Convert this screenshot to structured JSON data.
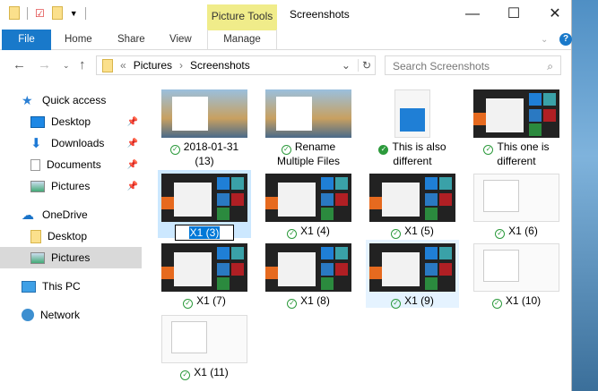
{
  "window": {
    "title": "Screenshots",
    "context_tab": "Picture Tools"
  },
  "ribbon": {
    "tabs": [
      "File",
      "Home",
      "Share",
      "View",
      "Manage"
    ]
  },
  "nav": {
    "breadcrumb": [
      "Pictures",
      "Screenshots"
    ],
    "overflow": "«",
    "search_placeholder": "Search Screenshots"
  },
  "sidebar": {
    "items": [
      {
        "label": "Quick access",
        "icon": "star-icon",
        "level": 0
      },
      {
        "label": "Desktop",
        "icon": "desktop-icon",
        "level": 1,
        "pinned": true
      },
      {
        "label": "Downloads",
        "icon": "download-icon",
        "level": 1,
        "pinned": true
      },
      {
        "label": "Documents",
        "icon": "documents-icon",
        "level": 1,
        "pinned": true
      },
      {
        "label": "Pictures",
        "icon": "pictures-icon",
        "level": 1,
        "pinned": true
      },
      {
        "label": "OneDrive",
        "icon": "cloud-icon",
        "level": 0
      },
      {
        "label": "Desktop",
        "icon": "folder-icon",
        "level": 1
      },
      {
        "label": "Pictures",
        "icon": "pictures-icon",
        "level": 1,
        "selected": true
      },
      {
        "label": "This PC",
        "icon": "pc-icon",
        "level": 0
      },
      {
        "label": "Network",
        "icon": "network-icon",
        "level": 0
      }
    ]
  },
  "files": [
    {
      "name": "2018-01-31 (13)",
      "thumb": "desk",
      "status": "synced"
    },
    {
      "name": "Rename Multiple Files",
      "thumb": "desk",
      "status": "synced"
    },
    {
      "name": "This is also different",
      "thumb": "file",
      "status": "available"
    },
    {
      "name": "This one is different",
      "thumb": "dark",
      "status": "synced"
    },
    {
      "name": "X1 (3)",
      "thumb": "dark",
      "status": "renaming",
      "selected": true
    },
    {
      "name": "X1 (4)",
      "thumb": "dark",
      "status": "synced"
    },
    {
      "name": "X1 (5)",
      "thumb": "dark",
      "status": "synced"
    },
    {
      "name": "X1 (6)",
      "thumb": "white",
      "status": "synced"
    },
    {
      "name": "X1 (7)",
      "thumb": "dark",
      "status": "synced"
    },
    {
      "name": "X1 (8)",
      "thumb": "dark",
      "status": "synced"
    },
    {
      "name": "X1 (9)",
      "thumb": "dark",
      "status": "synced",
      "hover": true
    },
    {
      "name": "X1 (10)",
      "thumb": "white",
      "status": "synced"
    },
    {
      "name": "X1 (11)",
      "thumb": "white",
      "status": "synced"
    }
  ]
}
